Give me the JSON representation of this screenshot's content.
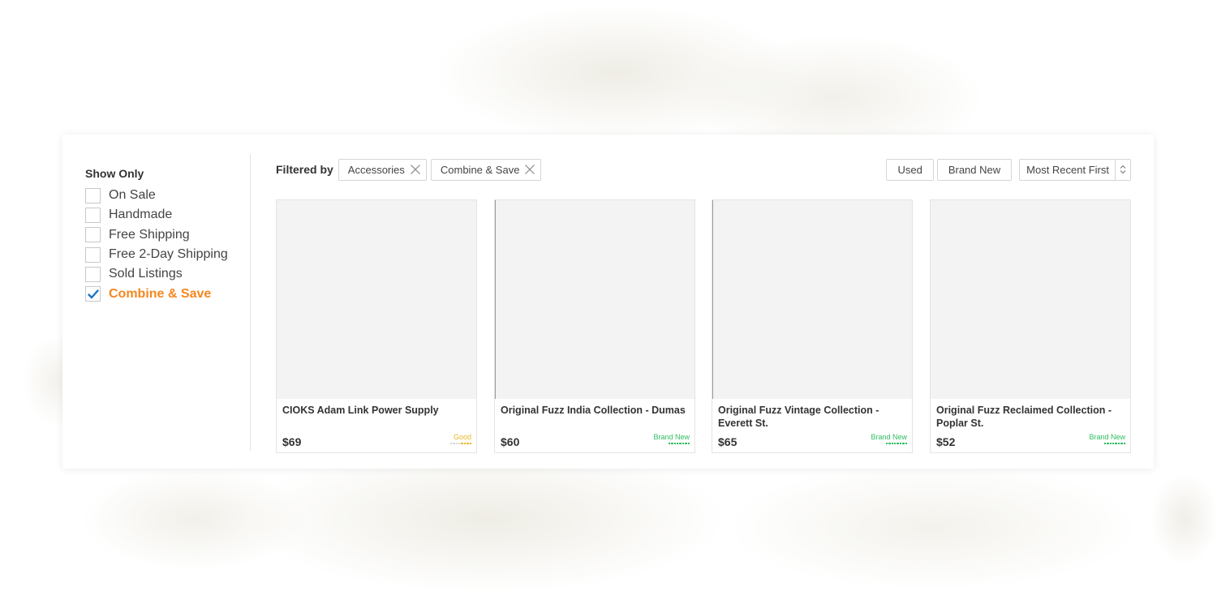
{
  "sidebar": {
    "heading": "Show Only",
    "items": [
      {
        "label": "On Sale",
        "checked": false
      },
      {
        "label": "Handmade",
        "checked": false
      },
      {
        "label": "Free Shipping",
        "checked": false
      },
      {
        "label": "Free 2-Day Shipping",
        "checked": false
      },
      {
        "label": "Sold Listings",
        "checked": false
      },
      {
        "label": "Combine & Save",
        "checked": true
      }
    ]
  },
  "filters": {
    "label": "Filtered by",
    "chips": [
      "Accessories",
      "Combine & Save"
    ]
  },
  "controls": {
    "used_label": "Used",
    "brand_new_label": "Brand New",
    "sort_label": "Most Recent First"
  },
  "listings": [
    {
      "title": "CIOKS Adam Link Power Supply",
      "price": "$69",
      "condition": "Good",
      "condition_level": 4,
      "condition_color": "#e8b823"
    },
    {
      "title": "Original Fuzz India Collection - Dumas",
      "price": "$60",
      "condition": "Brand New",
      "condition_level": 8,
      "condition_color": "#2ebd5f"
    },
    {
      "title": "Original Fuzz Vintage Collection - Everett St.",
      "price": "$65",
      "condition": "Brand New",
      "condition_level": 8,
      "condition_color": "#2ebd5f"
    },
    {
      "title": "Original Fuzz Reclaimed Collection - Poplar St.",
      "price": "$52",
      "condition": "Brand New",
      "condition_level": 8,
      "condition_color": "#2ebd5f"
    }
  ],
  "colors": {
    "accent_orange": "#f5871f",
    "check_blue": "#1a73c8",
    "thumb_placeholder": "#f3f3f3"
  }
}
